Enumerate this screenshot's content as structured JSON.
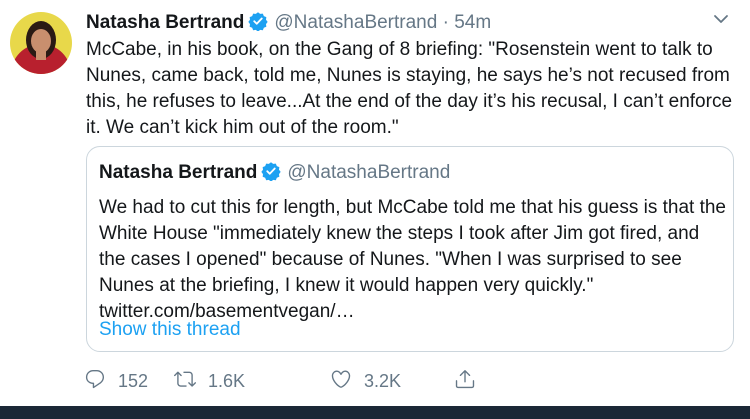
{
  "tweet": {
    "author_name": "Natasha Bertrand",
    "author_handle": "@NatashaBertrand",
    "separator": "·",
    "time": "54m",
    "text": "McCabe, in his book, on the Gang of 8 briefing: \"Rosenstein went to talk to Nunes, came back, told me, Nunes is staying, he says he’s not recused from this, he refuses to leave...At the end of the day it’s his recusal, I can’t enforce it. We can’t kick him out of the room.\""
  },
  "quote": {
    "author_name": "Natasha Bertrand",
    "author_handle": "@NatashaBertrand",
    "text": "We had to cut this for length, but McCabe told me that his guess is that the White House \"immediately knew the steps I took after Jim got fired, and the cases I opened\" because of Nunes. \"When I was surprised to see Nunes at the briefing, I knew it would happen very quickly.\"",
    "link": "twitter.com/basementvegan/…",
    "show_thread": "Show this thread"
  },
  "actions": {
    "replies": "152",
    "retweets": "1.6K",
    "likes": "3.2K"
  },
  "colors": {
    "verified": "#1da1f2",
    "secondary_text": "#657786",
    "link": "#1da1f2",
    "border": "#ccd6dd",
    "bottom_bar": "#1b2836"
  },
  "icons": [
    "verified-badge-icon",
    "chevron-down-icon",
    "reply-icon",
    "retweet-icon",
    "like-icon",
    "share-icon"
  ]
}
